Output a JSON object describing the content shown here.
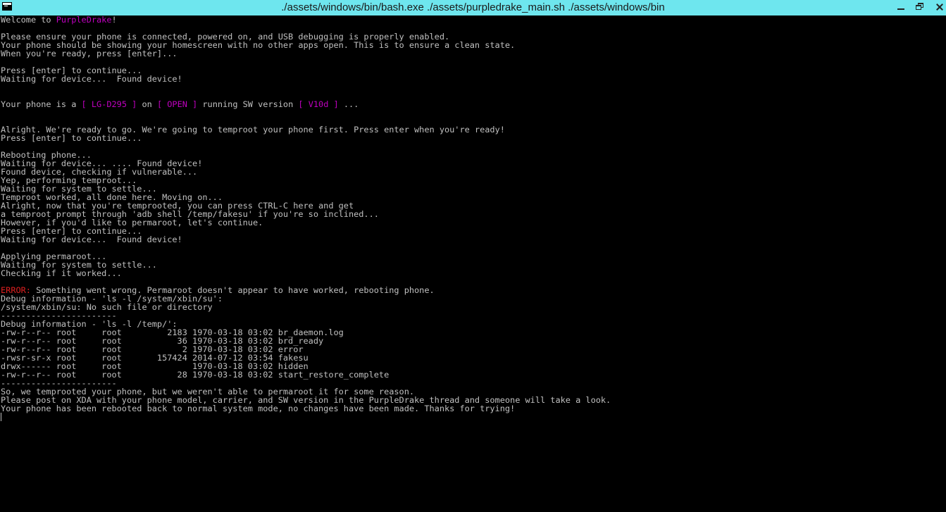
{
  "window": {
    "title": "./assets/windows/bin/bash.exe ./assets/purpledrake_main.sh ./assets/windows/bin",
    "icon": "console-icon",
    "controls": {
      "minimize": "minimize-icon",
      "maximize": "restore-icon",
      "close": "close-icon"
    }
  },
  "colors": {
    "titlebar": "#6ee6ee",
    "background": "#000000",
    "text": "#c0c0c0",
    "magenta": "#c000c0",
    "red": "#e02020"
  },
  "console": {
    "lines": [
      [
        {
          "t": "Welcome to "
        },
        {
          "t": "PurpleDrake",
          "c": "magenta"
        },
        {
          "t": "!"
        }
      ],
      [],
      [
        {
          "t": "Please ensure your phone is connected, powered on, and USB debugging is properly enabled."
        }
      ],
      [
        {
          "t": "Your phone should be showing your homescreen with no other apps open. This is to ensure a clean state."
        }
      ],
      [
        {
          "t": "When you're ready, press [enter]..."
        }
      ],
      [],
      [
        {
          "t": "Press [enter] to continue..."
        }
      ],
      [
        {
          "t": "Waiting for device...  Found device!"
        }
      ],
      [],
      [],
      [
        {
          "t": "Your phone is a "
        },
        {
          "t": "[ LG-D295 ]",
          "c": "magenta"
        },
        {
          "t": " on "
        },
        {
          "t": "[ OPEN ]",
          "c": "magenta"
        },
        {
          "t": " running SW version "
        },
        {
          "t": "[ V10d ]",
          "c": "magenta"
        },
        {
          "t": " ..."
        }
      ],
      [],
      [],
      [
        {
          "t": "Alright. We're ready to go. We're going to temproot your phone first. Press enter when you're ready!"
        }
      ],
      [
        {
          "t": "Press [enter] to continue..."
        }
      ],
      [],
      [
        {
          "t": "Rebooting phone..."
        }
      ],
      [
        {
          "t": "Waiting for device... .... Found device!"
        }
      ],
      [
        {
          "t": "Found device, checking if vulnerable..."
        }
      ],
      [
        {
          "t": "Yep, performing temproot..."
        }
      ],
      [
        {
          "t": "Waiting for system to settle..."
        }
      ],
      [
        {
          "t": "Temproot worked, all done here. Moving on..."
        }
      ],
      [
        {
          "t": "Alright, now that you're temprooted, you can press CTRL-C here and get"
        }
      ],
      [
        {
          "t": "a temproot prompt through 'adb shell /temp/fakesu' if you're so inclined..."
        }
      ],
      [
        {
          "t": "However, if you'd like to permaroot, let's continue."
        }
      ],
      [
        {
          "t": "Press [enter] to continue..."
        }
      ],
      [
        {
          "t": "Waiting for device...  Found device!"
        }
      ],
      [],
      [
        {
          "t": "Applying permaroot..."
        }
      ],
      [
        {
          "t": "Waiting for system to settle..."
        }
      ],
      [
        {
          "t": "Checking if it worked..."
        }
      ],
      [],
      [
        {
          "t": "ERROR:",
          "c": "red"
        },
        {
          "t": " Something went wrong. Permaroot doesn't appear to have worked, rebooting phone."
        }
      ],
      [
        {
          "t": "Debug information - 'ls -l /system/xbin/su':"
        }
      ],
      [
        {
          "t": "/system/xbin/su: No such file or directory"
        }
      ],
      [
        {
          "t": "-----------------------"
        }
      ],
      [
        {
          "t": "Debug information - 'ls -l /temp/':"
        }
      ],
      [
        {
          "t": "-rw-r--r-- root     root         2183 1970-03-18 03:02 br_daemon.log"
        }
      ],
      [
        {
          "t": "-rw-r--r-- root     root           36 1970-03-18 03:02 brd_ready"
        }
      ],
      [
        {
          "t": "-rw-r--r-- root     root            2 1970-03-18 03:02 error"
        }
      ],
      [
        {
          "t": "-rwsr-sr-x root     root       157424 2014-07-12 03:54 fakesu"
        }
      ],
      [
        {
          "t": "drwx------ root     root              1970-03-18 03:02 hidden"
        }
      ],
      [
        {
          "t": "-rw-r--r-- root     root           28 1970-03-18 03:02 start_restore_complete"
        }
      ],
      [
        {
          "t": "-----------------------"
        }
      ],
      [
        {
          "t": "So, we temprooted your phone, but we weren't able to permaroot it for some reason."
        }
      ],
      [
        {
          "t": "Please post on XDA with your phone model, carrier, and SW version in the PurpleDrake thread and someone will take a look."
        }
      ],
      [
        {
          "t": "Your phone has been rebooted back to normal system mode, no changes have been made. Thanks for trying!"
        }
      ]
    ]
  }
}
